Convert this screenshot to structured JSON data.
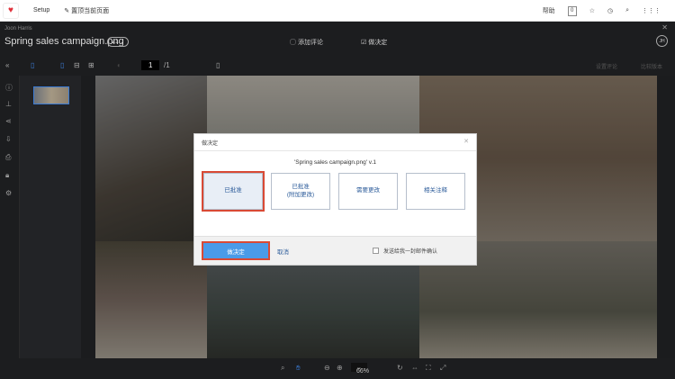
{
  "topbar": {
    "setup": "Setup",
    "pin": "置顶当前页面",
    "help": "帮助",
    "badge": "0"
  },
  "header": {
    "owner": "Joon Harris",
    "title": "Spring sales campaign.png",
    "version": "v.1",
    "add_comment": "添加评论",
    "decision": "做决定",
    "avatar": "JH"
  },
  "toolbar": {
    "page": "1",
    "page_total": "/1",
    "right1": "设置评论",
    "right2": "比较版本"
  },
  "bottom": {
    "zoom": "66%"
  },
  "dialog": {
    "title": "做决定",
    "file": "'Spring sales campaign.png' v.1",
    "options": [
      "已批准",
      "已批准\n(附加更改)",
      "需要更改",
      "相关注释"
    ],
    "confirm": "做决定",
    "cancel": "取消",
    "email": "发送给我一封邮件确认"
  }
}
